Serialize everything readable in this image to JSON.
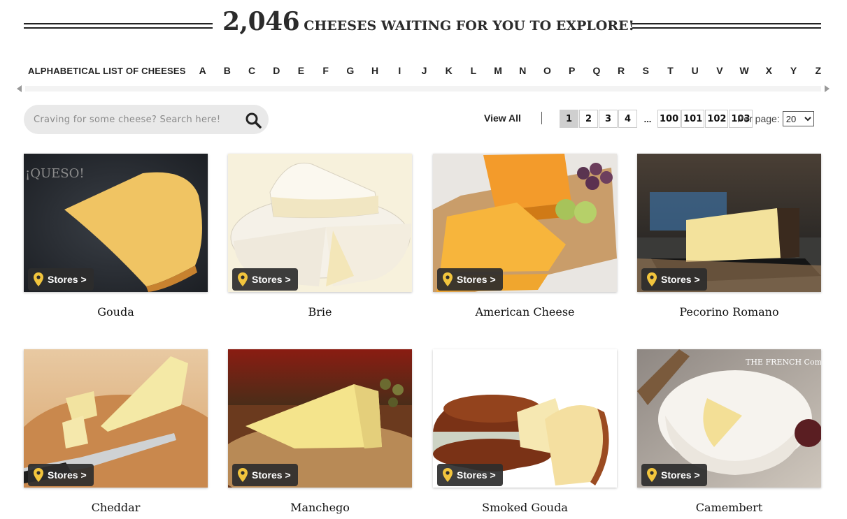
{
  "header": {
    "count": "2,046",
    "headline_rest": "CHEESES WAITING FOR YOU TO EXPLORE!"
  },
  "alphabet": {
    "title": "ALPHABETICAL LIST OF CHEESES",
    "letters": [
      "A",
      "B",
      "C",
      "D",
      "E",
      "F",
      "G",
      "H",
      "I",
      "J",
      "K",
      "L",
      "M",
      "N",
      "O",
      "P",
      "Q",
      "R",
      "S",
      "T",
      "U",
      "V",
      "W",
      "X",
      "Y",
      "Z"
    ]
  },
  "search": {
    "placeholder": "Craving for some cheese? Search here!",
    "icon": "search-icon"
  },
  "pagination": {
    "view_all": "View All",
    "pages_start": [
      "1",
      "2",
      "3",
      "4"
    ],
    "ellipsis": "...",
    "pages_end": [
      "100",
      "101",
      "102",
      "103"
    ],
    "current_page": "1",
    "per_page_label": "Per page:",
    "per_page_value": "20"
  },
  "stores_label": "Stores >",
  "cheeses": [
    {
      "name": "Gouda"
    },
    {
      "name": "Brie"
    },
    {
      "name": "American Cheese"
    },
    {
      "name": "Pecorino Romano"
    },
    {
      "name": "Cheddar"
    },
    {
      "name": "Manchego"
    },
    {
      "name": "Smoked Gouda"
    },
    {
      "name": "Camembert"
    }
  ],
  "colors": {
    "pin": "#f2c53d",
    "stores_bg": "#2d2d2d",
    "search_bg": "#e9e9e9"
  }
}
